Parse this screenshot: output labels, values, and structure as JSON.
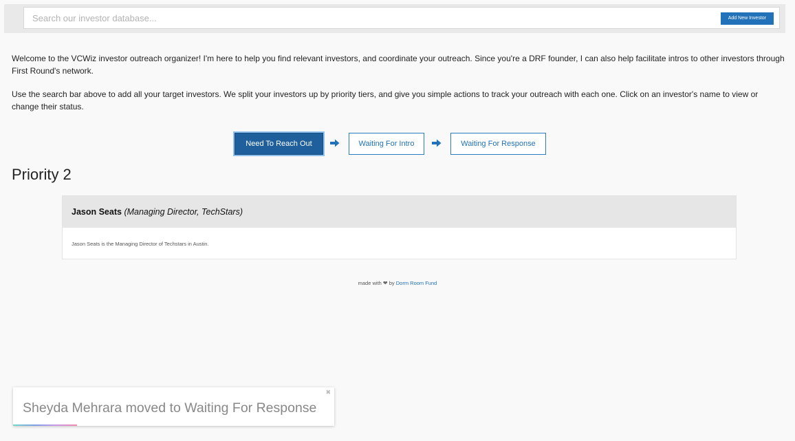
{
  "search": {
    "placeholder": "Search our investor database...",
    "add_button_label": "Add New Investor"
  },
  "intro": {
    "paragraph1": "Welcome to the VCWiz investor outreach organizer! I'm here to help you find relevant investors, and coordinate your outreach. Since you're a DRF founder, I can also help facilitate intros to other investors through First Round's network.",
    "paragraph2": "Use the search bar above to add all your target investors. We split your investors up by priority tiers, and give you simple actions to track your outreach with each one. Click on an investor's name to view or change their status."
  },
  "status_steps": [
    {
      "label": "Need To Reach Out",
      "active": true
    },
    {
      "label": "Waiting For Intro",
      "active": false
    },
    {
      "label": "Waiting For Response",
      "active": false
    }
  ],
  "priority": {
    "title": "Priority 2",
    "investors": [
      {
        "name": "Jason Seats",
        "role": "(Managing Director, TechStars)",
        "description": "Jason Seats is the Managing Director of Techstars in Austin."
      }
    ]
  },
  "footer": {
    "prefix": "made with",
    "heart": "❤",
    "by": "by",
    "link_text": "Dorm Room Fund"
  },
  "toast": {
    "message": "Sheyda Mehrara moved to Waiting For Response",
    "close_glyph": "✖",
    "progress": 0.2
  },
  "colors": {
    "accent": "#2172b8",
    "accent_active": "#1e5f9c",
    "card_header_bg": "#e6e6e6",
    "page_bg": "#f9f9f9"
  },
  "icons": {
    "step_arrow": "arrow-right-icon",
    "toast_close": "close-icon"
  }
}
